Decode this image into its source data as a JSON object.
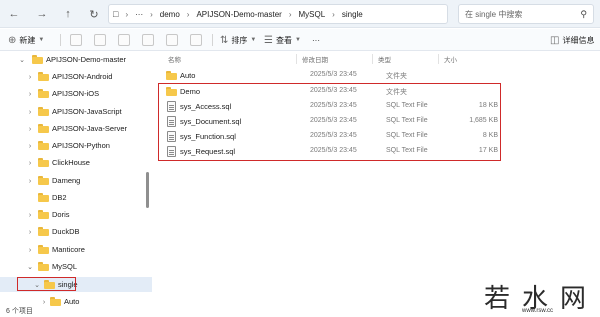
{
  "address": {
    "segments": [
      "demo",
      "APIJSON-Demo-master",
      "MySQL",
      "single"
    ],
    "search_placeholder": "在 single 中搜索"
  },
  "toolbar": {
    "new_label": "新建",
    "sort_label": "排序",
    "view_label": "查看",
    "more_label": "···",
    "details_label": "详细信息"
  },
  "nav": {
    "items": [
      {
        "label": "APIJSON-Demo-master"
      },
      {
        "label": "APIJSON-Android"
      },
      {
        "label": "APIJSON-iOS"
      },
      {
        "label": "APIJSON-JavaScript"
      },
      {
        "label": "APIJSON-Java-Server"
      },
      {
        "label": "APIJSON-Python"
      },
      {
        "label": "ClickHouse"
      },
      {
        "label": "Dameng"
      },
      {
        "label": "DB2"
      },
      {
        "label": "Doris"
      },
      {
        "label": "DuckDB"
      },
      {
        "label": "Manticore"
      },
      {
        "label": "MySQL"
      },
      {
        "label": "single"
      },
      {
        "label": "Auto"
      }
    ]
  },
  "columns": {
    "name": "名称",
    "date": "修改日期",
    "type": "类型",
    "size": "大小"
  },
  "files": [
    {
      "name": "Auto",
      "date": "2025/5/3 23:45",
      "type": "文件夹",
      "size": ""
    },
    {
      "name": "Demo",
      "date": "2025/5/3 23:45",
      "type": "文件夹",
      "size": ""
    },
    {
      "name": "sys_Access.sql",
      "date": "2025/5/3 23:45",
      "type": "SQL Text File",
      "size": "18 KB"
    },
    {
      "name": "sys_Document.sql",
      "date": "2025/5/3 23:45",
      "type": "SQL Text File",
      "size": "1,685 KB"
    },
    {
      "name": "sys_Function.sql",
      "date": "2025/5/3 23:45",
      "type": "SQL Text File",
      "size": "8 KB"
    },
    {
      "name": "sys_Request.sql",
      "date": "2025/5/3 23:45",
      "type": "SQL Text File",
      "size": "17 KB"
    }
  ],
  "status": {
    "count_label": "6 个项目"
  },
  "watermark": {
    "text": "若水网",
    "url": "www.rsw.cc"
  }
}
